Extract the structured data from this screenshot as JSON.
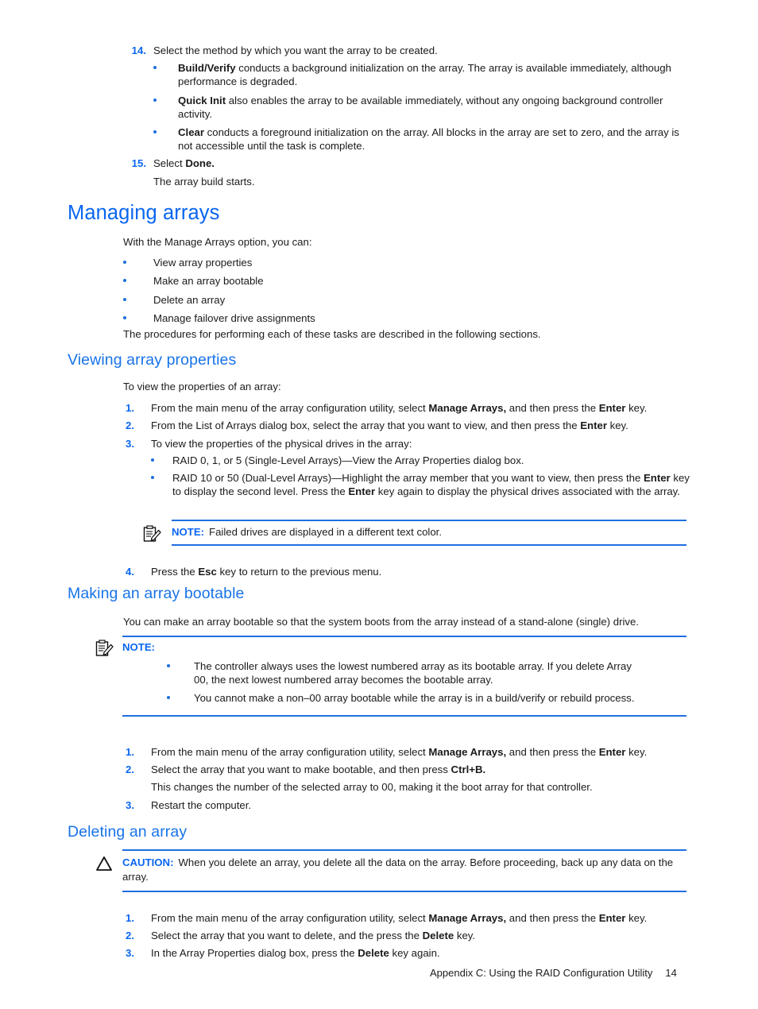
{
  "document": {
    "type": "technical-manual-page",
    "accent_color": "#0a66f0",
    "rule_color": "#1f6fe0",
    "text_color": "#1c1c1c"
  },
  "steps_top": {
    "item14": {
      "number": "14.",
      "text": "Select the method by which you want the array to be created.",
      "bullets": [
        {
          "lead": "Build/Verify",
          "rest": " conducts a background initialization on the array. The array is available immediately, although performance is degraded."
        },
        {
          "lead": "Quick Init",
          "rest": " also enables the array to be available immediately, without any ongoing background controller activity."
        },
        {
          "lead": "Clear",
          "rest": " conducts a foreground initialization on the array. All blocks in the array are set to zero, and the array is not accessible until the task is complete."
        }
      ]
    },
    "item15": {
      "number": "15.",
      "text_prefix": "Select ",
      "text_bold": "Done.",
      "followup": "The array build starts."
    }
  },
  "managing_arrays": {
    "heading": "Managing arrays",
    "intro": "With the Manage Arrays option, you can:",
    "bullets": [
      "View array properties",
      "Make an array bootable",
      "Delete an array",
      "Manage failover drive assignments"
    ],
    "closing": "The procedures for performing each of these tasks are described in the following sections."
  },
  "viewing_array_properties": {
    "heading": "Viewing array properties",
    "intro": "To view the properties of an array:",
    "steps": [
      {
        "number": "1.",
        "parts": [
          {
            "t": "From the main menu of the array configuration utility, select ",
            "b": false
          },
          {
            "t": "Manage Arrays,",
            "b": true
          },
          {
            "t": " and then press the ",
            "b": false
          },
          {
            "t": "Enter",
            "b": true
          },
          {
            "t": " key.",
            "b": false
          }
        ]
      },
      {
        "number": "2.",
        "parts": [
          {
            "t": "From the List of Arrays dialog box, select the array that you want to view, and then press the ",
            "b": false
          },
          {
            "t": "Enter",
            "b": true
          },
          {
            "t": " key.",
            "b": false
          }
        ]
      },
      {
        "number": "3.",
        "parts": [
          {
            "t": "To view the properties of the physical drives in the array:",
            "b": false
          }
        ]
      }
    ],
    "sub_bullets": [
      [
        {
          "t": "RAID 0, 1, or 5 (Single-Level Arrays)—View the Array Properties dialog box.",
          "b": false
        }
      ],
      [
        {
          "t": "RAID 10 or 50 (Dual-Level Arrays)—Highlight the array member that you want to view, then press the ",
          "b": false
        },
        {
          "t": "Enter",
          "b": true
        },
        {
          "t": " key to display the second level. Press the ",
          "b": false
        },
        {
          "t": "Enter",
          "b": true
        },
        {
          "t": " key again to display the physical drives associated with the array.",
          "b": false
        }
      ]
    ],
    "note": {
      "icon": "note-clipboard-icon",
      "label": "NOTE:",
      "text": "Failed drives are displayed in a different text color."
    },
    "step4": {
      "number": "4.",
      "parts": [
        {
          "t": "Press the ",
          "b": false
        },
        {
          "t": "Esc",
          "b": true
        },
        {
          "t": " key to return to the previous menu.",
          "b": false
        }
      ]
    }
  },
  "making_array_bootable": {
    "heading": "Making an array bootable",
    "intro": "You can make an array bootable so that the system boots from the array instead of a stand-alone (single) drive.",
    "note": {
      "icon": "note-clipboard-icon",
      "label": "NOTE:",
      "bullets": [
        "The controller always uses the lowest numbered array as its bootable array. If you delete Array 00, the next lowest numbered array becomes the bootable array.",
        "You cannot make a non–00 array bootable while the array is in a build/verify or rebuild process."
      ]
    },
    "steps": [
      {
        "number": "1.",
        "parts": [
          {
            "t": "From the main menu of the array configuration utility, select ",
            "b": false
          },
          {
            "t": "Manage Arrays,",
            "b": true
          },
          {
            "t": " and then press the ",
            "b": false
          },
          {
            "t": "Enter",
            "b": true
          },
          {
            "t": " key.",
            "b": false
          }
        ]
      },
      {
        "number": "2.",
        "parts": [
          {
            "t": "Select the array that you want to make bootable, and then press ",
            "b": false
          },
          {
            "t": "Ctrl+B.",
            "b": true
          }
        ],
        "followup": "This changes the number of the selected array to 00, making it the boot array for that controller."
      },
      {
        "number": "3.",
        "parts": [
          {
            "t": "Restart the computer.",
            "b": false
          }
        ]
      }
    ]
  },
  "deleting_an_array": {
    "heading": "Deleting an array",
    "caution": {
      "icon": "caution-triangle-icon",
      "label": "CAUTION:",
      "text": "When you delete an array, you delete all the data on the array. Before proceeding, back up any data on the array."
    },
    "steps": [
      {
        "number": "1.",
        "parts": [
          {
            "t": "From the main menu of the array configuration utility, select ",
            "b": false
          },
          {
            "t": "Manage Arrays,",
            "b": true
          },
          {
            "t": " and then press the ",
            "b": false
          },
          {
            "t": "Enter",
            "b": true
          },
          {
            "t": " key.",
            "b": false
          }
        ]
      },
      {
        "number": "2.",
        "parts": [
          {
            "t": "Select the array that you want to delete, and the press the ",
            "b": false
          },
          {
            "t": "Delete",
            "b": true
          },
          {
            "t": " key.",
            "b": false
          }
        ]
      },
      {
        "number": "3.",
        "parts": [
          {
            "t": "In the Array Properties dialog box, press the ",
            "b": false
          },
          {
            "t": "Delete",
            "b": true
          },
          {
            "t": " key again.",
            "b": false
          }
        ]
      }
    ]
  },
  "footer": {
    "text": "Appendix C: Using the RAID Configuration Utility",
    "page_number": "14"
  }
}
